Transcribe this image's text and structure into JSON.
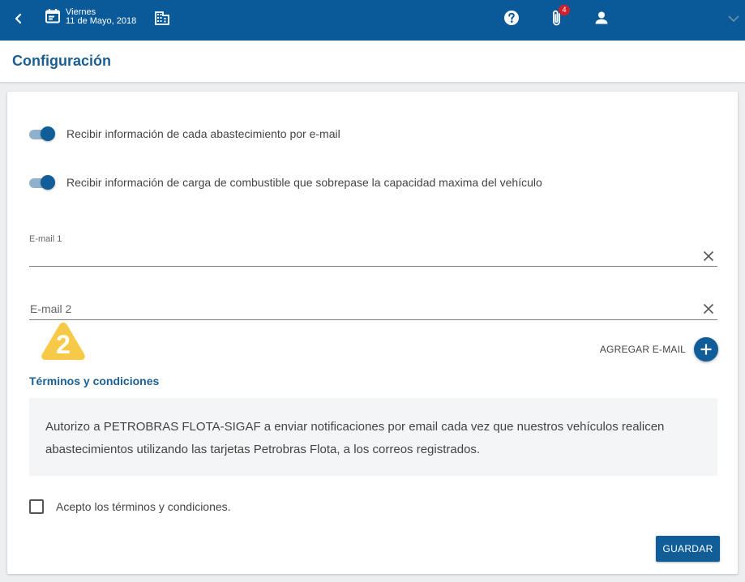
{
  "header": {
    "day": "Viernes",
    "date": "11 de Mayo, 2018",
    "notification_count": "4",
    "icons": [
      "back-arrow-icon",
      "calendar-icon",
      "building-icon",
      "help-icon",
      "paperclip-icon",
      "person-icon",
      "chevron-down-icon"
    ]
  },
  "page": {
    "title": "Configuración"
  },
  "settings": {
    "toggles": [
      {
        "label": "Recibir información de cada abastecimiento por e-mail",
        "on": true
      },
      {
        "label": "Recibir información de carga de combustible que sobrepase la capacidad maxima del vehículo",
        "on": true
      }
    ],
    "email1": {
      "label": "E-mail 1",
      "value": ""
    },
    "email2": {
      "label": "E-mail 2",
      "value": ""
    },
    "marker_number": "2",
    "add_email_label": "AGREGAR E-MAIL"
  },
  "terms": {
    "title": "Términos y condiciones",
    "text": "Autorizo a PETROBRAS FLOTA-SIGAF a enviar notificaciones por email cada vez que nuestros vehículos realicen abastecimientos utilizando las tarjetas Petrobras Flota, a los correos registrados.",
    "accept_label": "Acepto los términos y condiciones.",
    "accepted": false
  },
  "actions": {
    "save_label": "GUARDAR"
  },
  "colors": {
    "primary": "#0a5a9a",
    "title_text": "#1a5f93",
    "badge": "#d0202b",
    "marker": "#f7c948"
  }
}
